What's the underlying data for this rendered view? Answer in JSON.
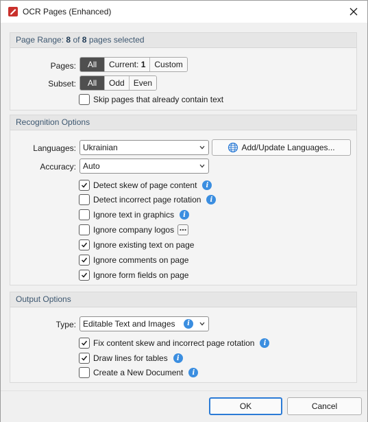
{
  "window": {
    "title": "OCR Pages (Enhanced)"
  },
  "page_range": {
    "header_prefix": "Page Range:",
    "selected": "8",
    "of_word": "of",
    "total": "8",
    "suffix": "pages selected",
    "pages_label": "Pages:",
    "pages_options": [
      "All",
      "Current:",
      "Custom"
    ],
    "current_number": "1",
    "subset_label": "Subset:",
    "subset_options": [
      "All",
      "Odd",
      "Even"
    ],
    "skip_text": "Skip pages that already contain text",
    "skip_checked": false
  },
  "recognition": {
    "header": "Recognition Options",
    "languages_label": "Languages:",
    "languages_value": "Ukrainian",
    "add_languages_button": "Add/Update Languages...",
    "accuracy_label": "Accuracy:",
    "accuracy_value": "Auto",
    "options": [
      {
        "label": "Detect skew of page content",
        "checked": true,
        "info": true
      },
      {
        "label": "Detect incorrect page rotation",
        "checked": false,
        "info": true
      },
      {
        "label": "Ignore text in graphics",
        "checked": false,
        "info": true
      },
      {
        "label": "Ignore company logos",
        "checked": false,
        "more": true
      },
      {
        "label": "Ignore existing text on page",
        "checked": true
      },
      {
        "label": "Ignore comments on page",
        "checked": true
      },
      {
        "label": "Ignore form fields on page",
        "checked": true
      }
    ]
  },
  "output": {
    "header": "Output Options",
    "type_label": "Type:",
    "type_value": "Editable Text and Images",
    "options": [
      {
        "label": "Fix content skew and incorrect page rotation",
        "checked": true,
        "info": true
      },
      {
        "label": "Draw lines for tables",
        "checked": true,
        "info": true
      },
      {
        "label": "Create a New Document",
        "checked": false,
        "info": true
      }
    ]
  },
  "buttons": {
    "ok": "OK",
    "cancel": "Cancel"
  },
  "colors": {
    "accent": "#2b7bd6",
    "selected_segment": "#4f4f4f",
    "info": "#3b8ee0",
    "header_text": "#3d5770"
  }
}
